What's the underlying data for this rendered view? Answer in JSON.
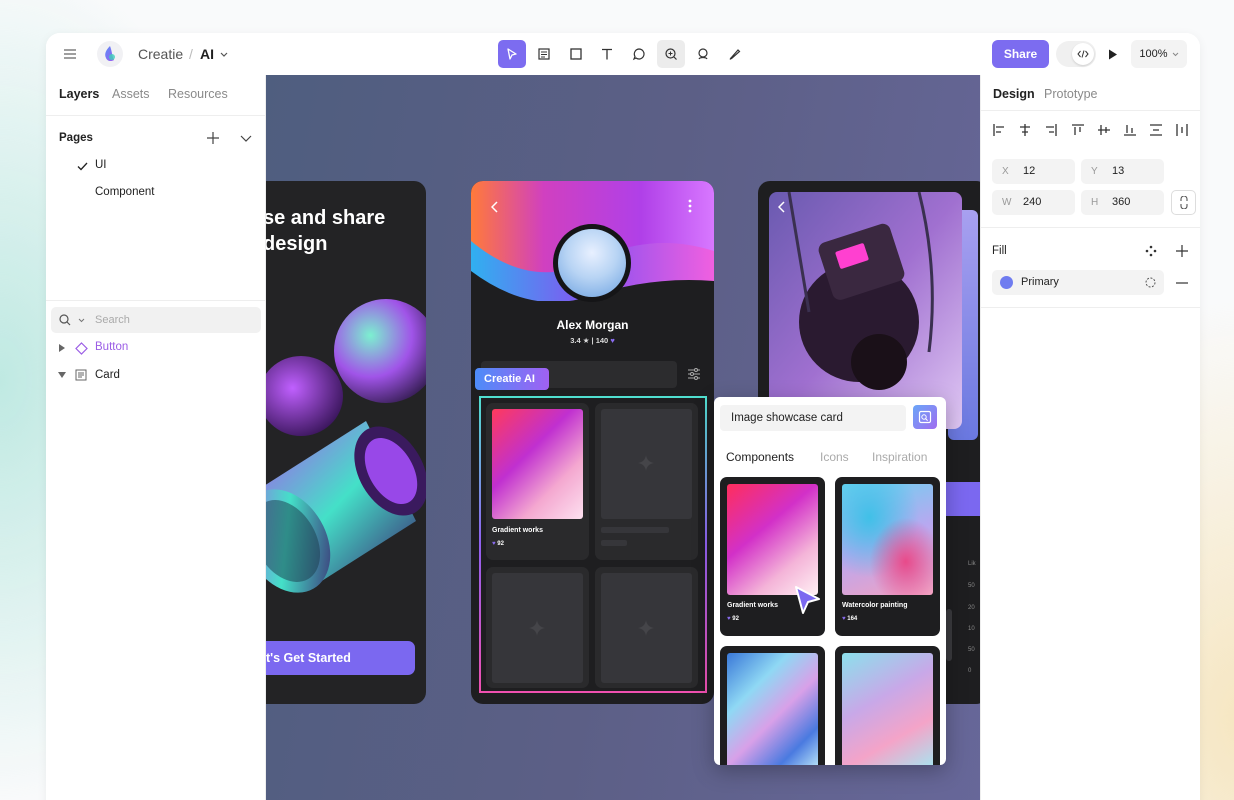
{
  "app": {
    "project": "Creatie",
    "file": "AI",
    "share_label": "Share",
    "zoom": "100%"
  },
  "left_panel": {
    "tabs": [
      "Layers",
      "Assets",
      "Resources"
    ],
    "pages_title": "Pages",
    "pages": [
      "UI",
      "Component"
    ],
    "search_placeholder": "Search",
    "layers": [
      "Button",
      "Card"
    ]
  },
  "right_panel": {
    "tabs": [
      "Design",
      "Prototype"
    ],
    "x_label": "X",
    "x": "12",
    "y_label": "Y",
    "y": "13",
    "w_label": "W",
    "w": "240",
    "h_label": "H",
    "h": "360",
    "fill_title": "Fill",
    "fill_name": "Primary"
  },
  "canvas": {
    "headline": [
      "se and share",
      "design"
    ],
    "cta": "et's Get Started",
    "profile_name": "Alex Morgan",
    "profile_stats": "3.4  ★  |  140",
    "ai_badge": "Creatie AI",
    "tile1_title": "Gradient works",
    "tile1_likes": "92",
    "popup_input": "Image showcase card",
    "popup_tabs": [
      "Components",
      "Icons",
      "Inspiration"
    ],
    "pop_card1_title": "Gradient works",
    "pop_card1_likes": "92",
    "pop_card2_title": "Watercolor painting",
    "pop_card2_likes": "164",
    "chart_ticks": [
      "Lik",
      "50",
      "20",
      "10",
      "50",
      "0"
    ]
  },
  "colors": {
    "accent": "#7c6cf0",
    "fill_primary": "#6f7cf0",
    "canvas_bg": "#5c5f86"
  }
}
